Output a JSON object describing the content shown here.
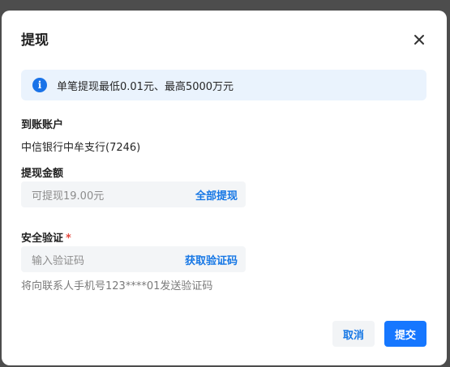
{
  "dialog": {
    "title": "提现",
    "close_icon": "close-icon"
  },
  "info": {
    "icon": "info-icon",
    "icon_glyph": "i",
    "text": "单笔提现最低0.01元、最高5000万元"
  },
  "account": {
    "label": "到账账户",
    "value": "中信银行中牟支行(7246)"
  },
  "amount": {
    "label": "提现金额",
    "placeholder": "可提现19.00元",
    "action": "全部提现"
  },
  "verify": {
    "label": "安全验证",
    "required_mark": "*",
    "placeholder": "输入验证码",
    "action": "获取验证码",
    "hint": "将向联系人手机号123****01发送验证码"
  },
  "footer": {
    "cancel_label": "取消",
    "submit_label": "提交"
  },
  "colors": {
    "accent": "#1677ff",
    "info_bg": "#eaf3fd",
    "required": "#e5483e"
  }
}
